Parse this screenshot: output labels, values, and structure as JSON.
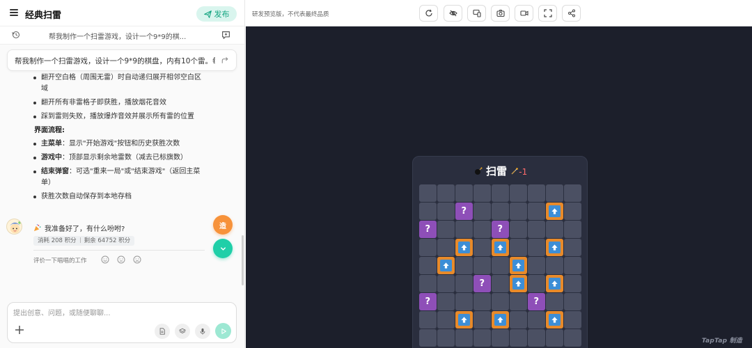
{
  "header": {
    "title": "经典扫雷",
    "publish_label": "发布"
  },
  "history": {
    "text": "帮我制作一个扫雷游戏，设计一个9*9的棋..."
  },
  "prompt": {
    "text": "帮我制作一个扫雷游戏，设计一个9*9的棋盘，内有10个雷。每..."
  },
  "content": {
    "bullets_top": [
      "翻开空白格（周围无雷）时自动递归展开相邻空白区域",
      "翻开所有非雷格子即获胜，播放烟花音效",
      "踩到雷则失败，播放爆炸音效并展示所有雷的位置"
    ],
    "section_title": "界面流程:",
    "flow": [
      {
        "label": "主菜单",
        "text": "：显示\"开始游戏\"按钮和历史获胜次数"
      },
      {
        "label": "游戏中",
        "text": "：顶部显示剩余地雷数（减去已标旗数）"
      },
      {
        "label": "结束弹窗",
        "text": "：可选\"重来一局\"或\"结束游戏\"（返回主菜单）"
      }
    ],
    "last_bullet": "获胜次数自动保存到本地存档"
  },
  "assistant": {
    "message": "我准备好了，有什么吩咐?",
    "credits_used": "消耗 208 积分",
    "credits_left": "剩余 64752 积分",
    "rate_prompt": "评价一下唱唱的工作"
  },
  "fab": {
    "orange_label": "造"
  },
  "composer": {
    "placeholder": "提出创意、问题，或随便聊聊..."
  },
  "preview": {
    "note": "研发预览版，不代表最终品质",
    "toolbar": [
      "refresh-icon",
      "hide-icon",
      "device-icon",
      "screenshot-icon",
      "record-icon",
      "fullscreen-icon",
      "share-icon"
    ]
  },
  "game": {
    "title": "扫雷",
    "mine_count": "-1",
    "rows": 9,
    "cols": 9,
    "board": [
      "_________",
      "__Q____F_",
      "Q___Q____",
      "__F_F__F_",
      "_F___F___",
      "___Q_F_F_",
      "Q_____Q__",
      "__F_F__F_",
      "_________"
    ],
    "question_mark": "?"
  },
  "watermark": "TapTap 制造",
  "colors": {
    "accent": "#1fcfa8",
    "orange": "#f7923a",
    "cell": "#4b5063",
    "question": "#8e4fb8",
    "flag_border": "#e88a2a",
    "flag_fill": "#3d8ed6",
    "stage_bg": "#1c1f2b"
  }
}
